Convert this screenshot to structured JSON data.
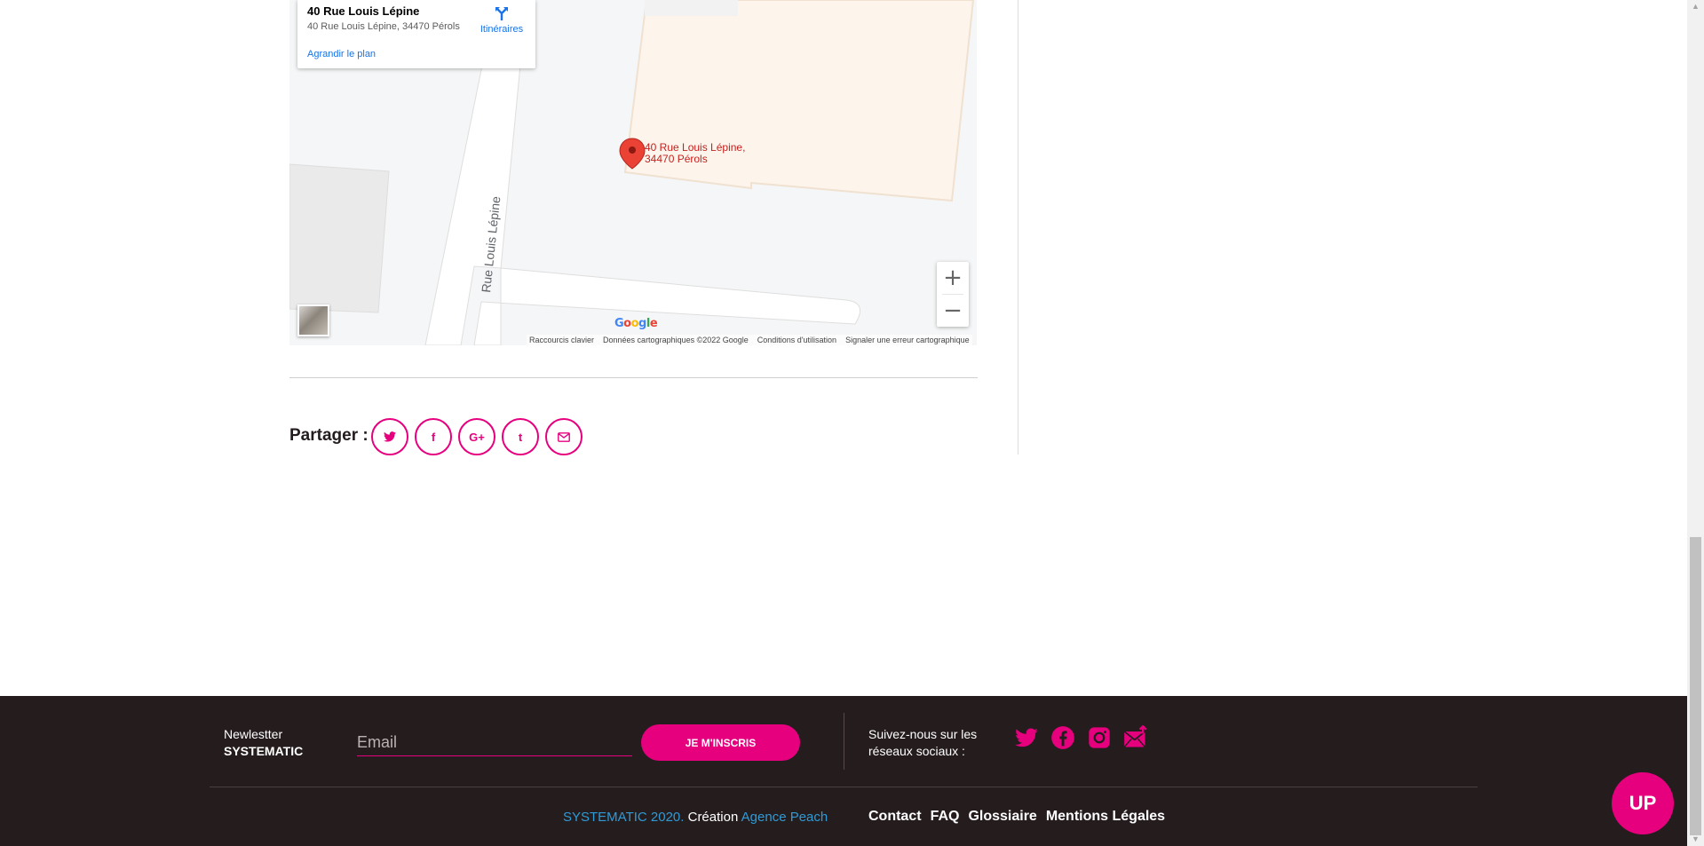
{
  "map": {
    "card_title": "40 Rue Louis Lépine",
    "card_address": "40 Rue Louis Lépine, 34470 Pérols",
    "directions_label": "Itinéraires",
    "enlarge_label": "Agrandir le plan",
    "pin_label": "40 Rue Louis Lépine, 34470 Pérols",
    "street_label": "Rue Louis Lépine",
    "google_logo": "Google",
    "zoom_in": "+",
    "zoom_out": "−",
    "footer_links": [
      "Raccourcis clavier",
      "Données cartographiques ©2022 Google",
      "Conditions d'utilisation",
      "Signaler une erreur cartographique"
    ]
  },
  "share": {
    "label": "Partager :",
    "buttons": [
      {
        "name": "twitter",
        "glyph": "🐦"
      },
      {
        "name": "facebook",
        "glyph": "f"
      },
      {
        "name": "google-plus",
        "glyph": "G+"
      },
      {
        "name": "tumblr",
        "glyph": "t"
      },
      {
        "name": "email",
        "glyph": "✉"
      }
    ]
  },
  "footer": {
    "newsletter_line1": "Newlestter",
    "newsletter_line2": "SYSTEMATIC",
    "email_placeholder": "Email",
    "subscribe_label": "JE M'INSCRIS",
    "follow_label": "Suivez-nous sur les réseaux sociaux :",
    "copyright_brand": "SYSTEMATIC 2020.",
    "copyright_text": " Création ",
    "copyright_agency": "Agence Peach",
    "links": [
      "Contact",
      "FAQ",
      "Glossiaire",
      "Mentions Légales"
    ],
    "up_label": "UP"
  },
  "colors": {
    "accent": "#e6007e",
    "footer_bg": "#251c1e",
    "link_blue": "#2e9bd6"
  }
}
